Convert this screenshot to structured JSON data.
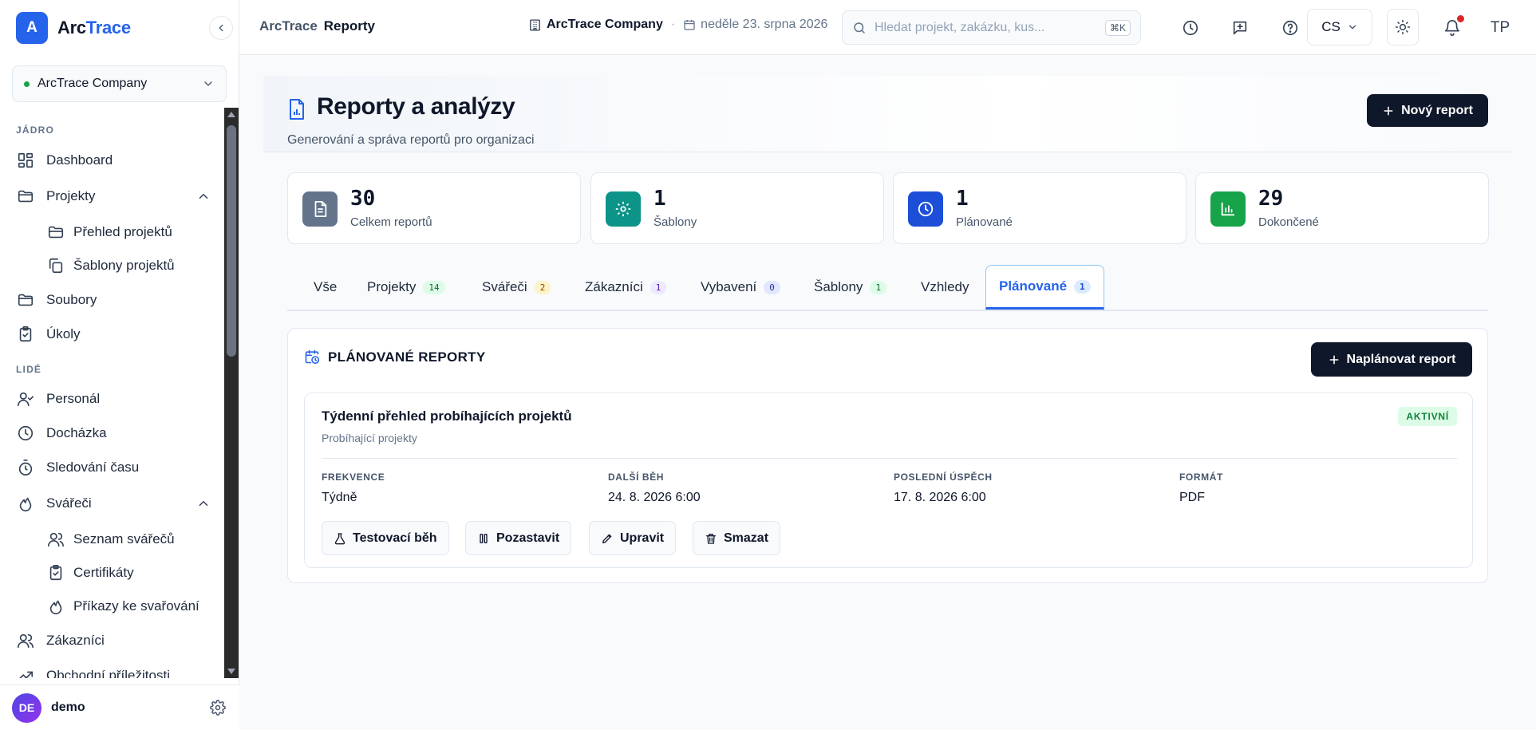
{
  "brand": {
    "logo_letter": "A",
    "name_part1": "Arc",
    "name_part2": "Trace"
  },
  "company_selector": {
    "label": "ArcTrace Company"
  },
  "sidebar": {
    "sections": {
      "core": "JÁDRO",
      "people": "LIDÉ"
    },
    "items": {
      "dashboard": "Dashboard",
      "projects": "Projekty",
      "projects_overview": "Přehled projektů",
      "project_templates": "Šablony projektů",
      "files": "Soubory",
      "tasks": "Úkoly",
      "personnel": "Personál",
      "attendance": "Docházka",
      "time_tracking": "Sledování času",
      "welders": "Svářeči",
      "welder_list": "Seznam svářečů",
      "certificates": "Certifikáty",
      "welding_orders": "Příkazy ke svařování",
      "customers": "Zákazníci",
      "opportunities": "Obchodní příležitosti"
    },
    "user": {
      "initials": "DE",
      "name": "demo"
    }
  },
  "topbar": {
    "breadcrumb": [
      "ArcTrace",
      "Reporty"
    ],
    "company": "ArcTrace Company",
    "date": "neděle 23. srpna 2026",
    "search_placeholder": "Hledat projekt, zakázku, kus...",
    "search_shortcut": "⌘K",
    "language": "CS",
    "user_initials": "TP"
  },
  "page": {
    "title": "Reporty a analýzy",
    "subtitle": "Generování a správa reportů pro organizaci",
    "new_report_label": "Nový report"
  },
  "stats": [
    {
      "value": "30",
      "label": "Celkem reportů",
      "color": "#64748b",
      "icon": "document-icon"
    },
    {
      "value": "1",
      "label": "Šablony",
      "color": "#0d9488",
      "icon": "gear-icon"
    },
    {
      "value": "1",
      "label": "Plánované",
      "color": "#1d4ed8",
      "icon": "clock-icon"
    },
    {
      "value": "29",
      "label": "Dokončené",
      "color": "#16a34a",
      "icon": "bar-chart-icon"
    }
  ],
  "tabs": [
    {
      "label": "Vše",
      "count": null
    },
    {
      "label": "Projekty",
      "count": "14"
    },
    {
      "label": "Svářeči",
      "count": "2"
    },
    {
      "label": "Zákazníci",
      "count": "1"
    },
    {
      "label": "Vybavení",
      "count": "0"
    },
    {
      "label": "Šablony",
      "count": "1"
    },
    {
      "label": "Vzhledy",
      "count": null
    },
    {
      "label": "Plánované",
      "count": "1",
      "active": true
    }
  ],
  "scheduled": {
    "title": "PLÁNOVANÉ REPORTY",
    "schedule_button": "Naplánovat report",
    "report": {
      "name": "Týdenní přehled probíhajících projektů",
      "source": "Probíhající projekty",
      "status": "AKTIVNÍ",
      "frequency_label": "FREKVENCE",
      "frequency": "Týdně",
      "next_run_label": "DALŠÍ BĚH",
      "next_run": "24. 8. 2026 6:00",
      "last_success_label": "POSLEDNÍ ÚSPĚCH",
      "last_success": "17. 8. 2026 6:00",
      "format_label": "FORMÁT",
      "format": "PDF",
      "actions": {
        "test_run": "Testovací běh",
        "pause": "Pozastavit",
        "edit": "Upravit",
        "delete": "Smazat"
      }
    }
  }
}
